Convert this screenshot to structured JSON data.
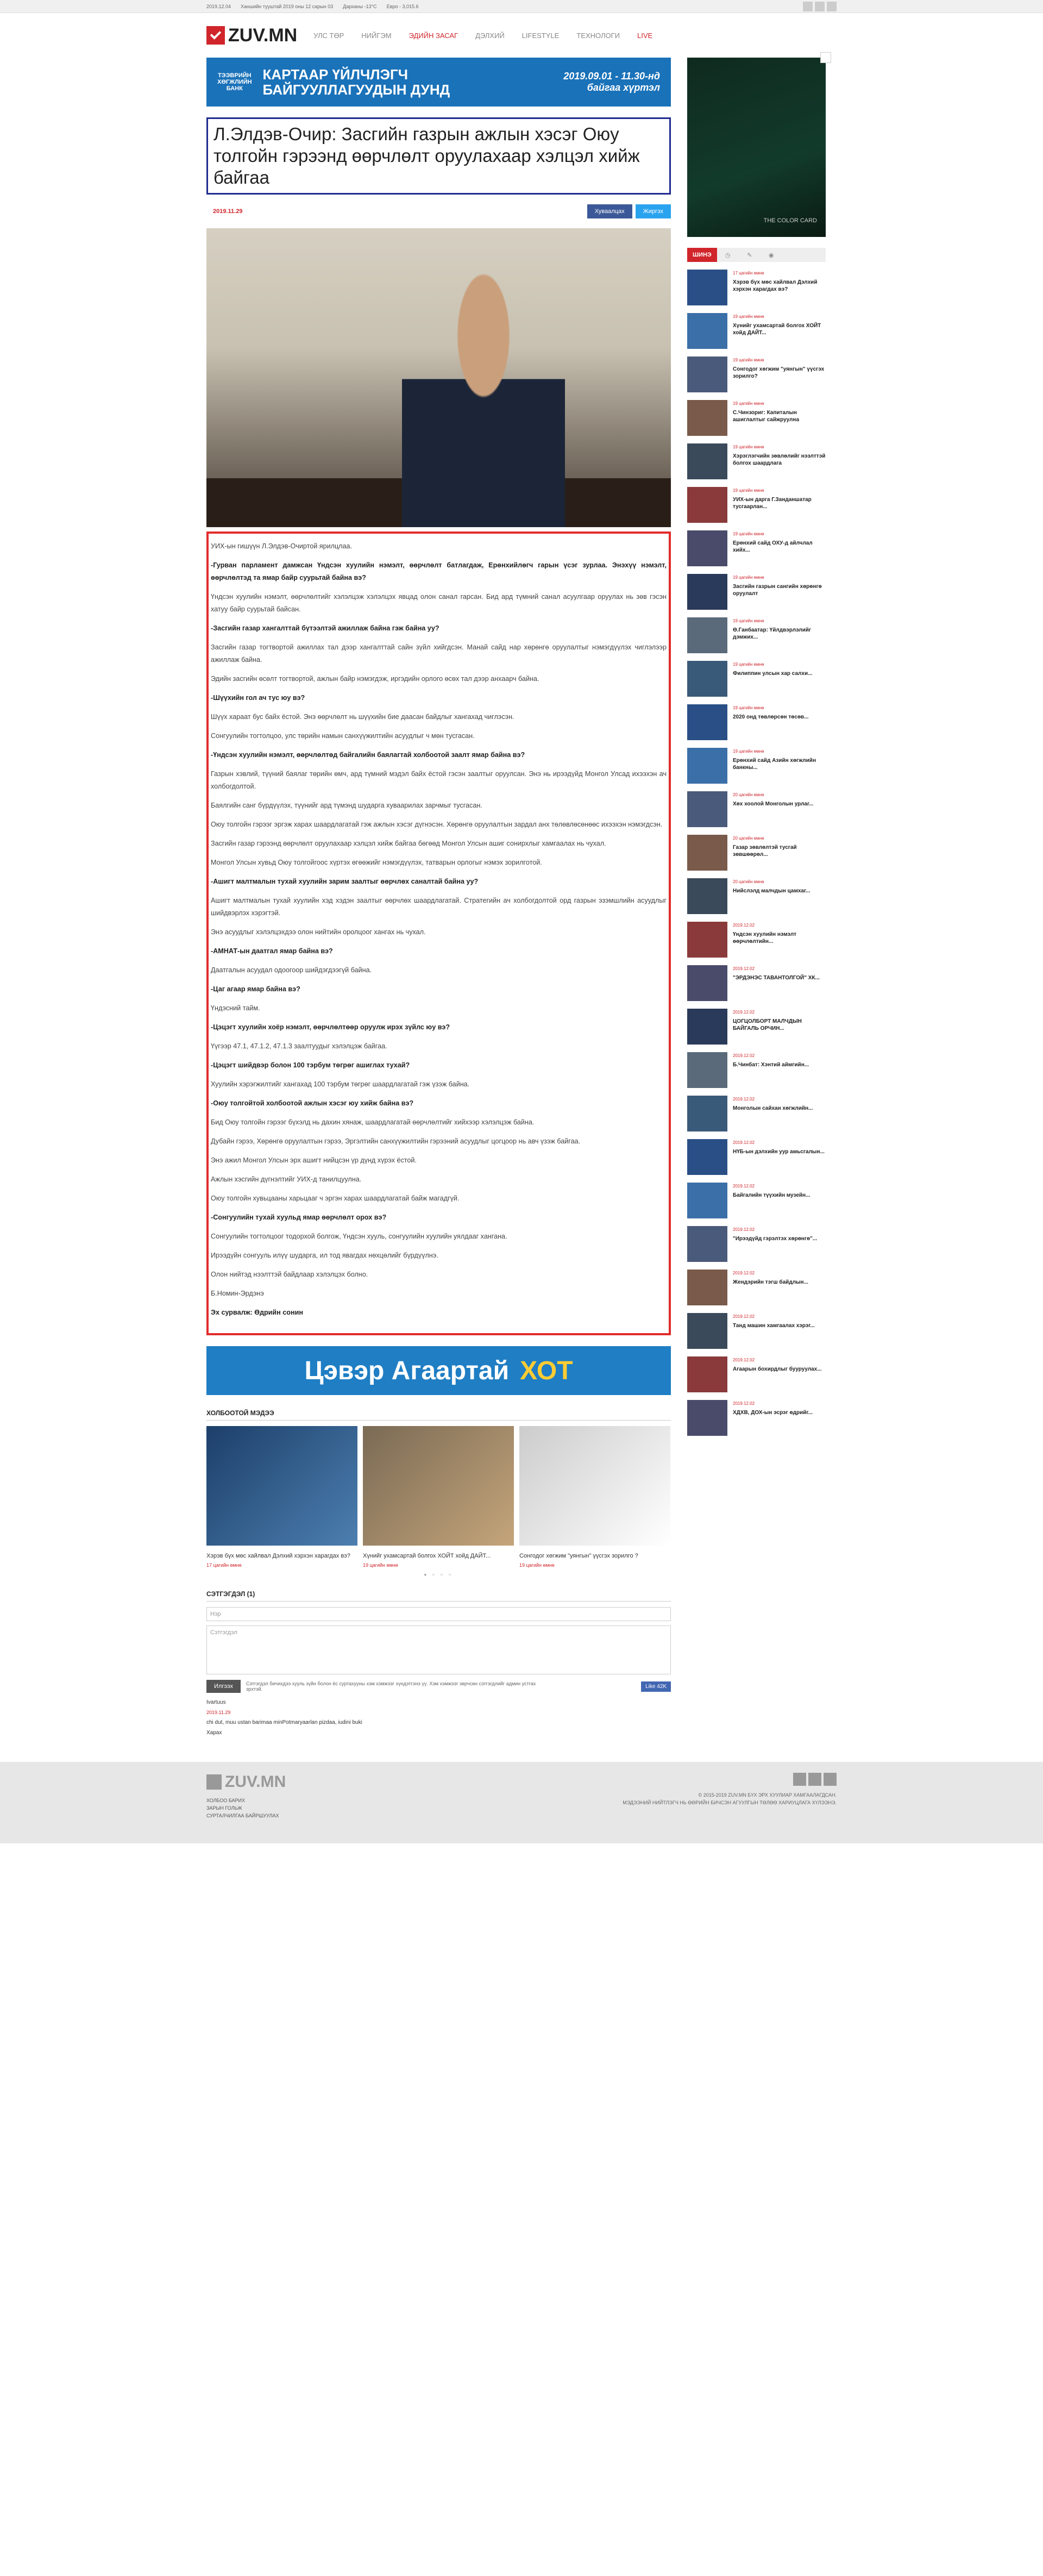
{
  "topbar": {
    "date": "2019.12.04",
    "exchange": "Ханшийн тууштай 2019 оны 12 сарын 03",
    "weather": "Дарханы -13°С",
    "currency": "Евро - 3,015.6"
  },
  "header": {
    "logo": "ZUV.MN",
    "nav": [
      "УЛС ТӨР",
      "НИЙГЭМ",
      "ЭДИЙН ЗАСАГ",
      "ДЭЛХИЙ",
      "LIFESTYLE",
      "ТЕХНОЛОГИ",
      "LIVE"
    ]
  },
  "banner1": {
    "brand": "ТЭЭВРИЙН ХӨГЖЛИЙН БАНК",
    "text": "КАРТААР ҮЙЛЧЛЭГЧ БАЙГУУЛЛАГУУДЫН ДУНД",
    "date": "2019.09.01 - 11.30-нд байгаа хүртэл"
  },
  "article": {
    "title": "Л.Элдэв-Очир: Засгийн газрын ажлын хэсэг Оюу толгойн гэрээнд өөрчлөлт оруулахаар хэлцэл хийж байгаа",
    "date": "2019.11.29",
    "share_fb": "Хуваалцах",
    "share_tw": "Жиргэх",
    "paragraphs": [
      {
        "q": false,
        "text": "УИХ-ын гишүүн Л.Элдэв-Очиртой ярилцлаа."
      },
      {
        "q": true,
        "text": "-Гурван парламент дамжсан Үндсэн хуулийн нэмэлт, өөрчлөлт батлагдаж, Ерөнхийлөгч гарын үсэг зурлаа. Энэхүү нэмэлт, өөрчлөлтэд та ямар байр суурьтай байна вэ?"
      },
      {
        "q": false,
        "text": "Үндсэн хуулийн нэмэлт, өөрчлөлтийг хэлэлцэж хэлэлцэх явцад олон санал гарсан. Бид ард түмний санал асуулгаар оруулах нь зөв гэсэн хатуу байр суурьтай байсан."
      },
      {
        "q": true,
        "text": "-Засгийн газар хангалттай бүтээлтэй ажиллаж байна гэж байна уу?"
      },
      {
        "q": false,
        "text": "Засгийн газар тогтвортой ажиллах тал дээр хангалттай сайн зүйл хийгдсэн. Манай сайд нар хөрөнгө оруулалтыг нэмэгдүүлэх чиглэлээр ажиллаж байна."
      },
      {
        "q": false,
        "text": "Эдийн засгийн өсөлт тогтвортой, ажлын байр нэмэгдэж, иргэдийн орлого өсөх тал дээр анхаарч байна."
      },
      {
        "q": true,
        "text": "-Шүүхийн гол ач тус юу вэ?"
      },
      {
        "q": false,
        "text": "Шүүх хараат бус байх ёстой. Энэ өөрчлөлт нь шүүхийн бие даасан байдлыг хангахад чиглэсэн."
      },
      {
        "q": false,
        "text": "Сонгуулийн тогтолцоо, улс төрийн намын санхүүжилтийн асуудлыг ч мөн тусгасан."
      },
      {
        "q": true,
        "text": "-Үндсэн хуулийн нэмэлт, өөрчлөлтөд байгалийн баялагтай холбоотой заалт ямар байна вэ?"
      },
      {
        "q": false,
        "text": "Газрын хэвлий, түүний баялаг төрийн өмч, ард түмний мэдэл байх ёстой гэсэн заалтыг оруулсан. Энэ нь ирээдүйд Монгол Улсад ихээхэн ач холбогдолтой."
      },
      {
        "q": false,
        "text": "Баялгийн санг бүрдүүлэх, түүнийг ард түмэнд шударга хуваарилах зарчмыг тусгасан."
      },
      {
        "q": false,
        "text": "Оюу толгойн гэрээг эргэж харах шаардлагатай гэж ажлын хэсэг дүгнэсэн. Хөрөнгө оруулалтын зардал анх төлөвлөсөнөөс ихээхэн нэмэгдсэн."
      },
      {
        "q": false,
        "text": "Засгийн газар гэрээнд өөрчлөлт оруулахаар хэлцэл хийж байгаа бөгөөд Монгол Улсын ашиг сонирхлыг хамгаалах нь чухал."
      },
      {
        "q": false,
        "text": "Монгол Улсын хувьд Оюу толгойгоос хүртэх өгөөжийг нэмэгдүүлэх, татварын орлогыг нэмэх зорилготой."
      },
      {
        "q": true,
        "text": "-Ашигт малтмалын тухай хуулийн зарим заалтыг өөрчлөх саналтай байна уу?"
      },
      {
        "q": false,
        "text": "Ашигт малтмалын тухай хуулийн хэд хэдэн заалтыг өөрчлөх шаардлагатай. Стратегийн ач холбогдолтой орд газрын эзэмшлийн асуудлыг шийдвэрлэх хэрэгтэй."
      },
      {
        "q": false,
        "text": "Энэ асуудлыг хэлэлцэхдээ олон нийтийн оролцоог хангах нь чухал."
      },
      {
        "q": true,
        "text": "-АМНАТ-ын даатгал ямар байна вэ?"
      },
      {
        "q": false,
        "text": "Даатгалын асуудал одоогоор шийдэгдээгүй байна."
      },
      {
        "q": true,
        "text": "-Цаг агаар ямар байна вэ?"
      },
      {
        "q": false,
        "text": "Үндэсний тайм."
      },
      {
        "q": true,
        "text": "-Цэцэгт хуулийн хоёр нэмэлт, өөрчлөлтөөр оруулж ирэх зүйлс юу вэ?"
      },
      {
        "q": false,
        "text": "Үүгээр 47.1, 47.1.2, 47.1.3 заалтуудыг хэлэлцэж байгаа."
      },
      {
        "q": true,
        "text": "-Цэцэгт шийдвэр болон 100 тэрбум төгрөг ашиглах тухай?"
      },
      {
        "q": false,
        "text": "Хуулийн хэрэгжилтийг хангахад 100 тэрбум төгрөг шаардлагатай гэж үзэж байна."
      },
      {
        "q": true,
        "text": "-Оюу толгойтой холбоотой ажлын хэсэг юу хийж байна вэ?"
      },
      {
        "q": false,
        "text": "Бид Оюу толгойн гэрээг бүхэлд нь дахин хянаж, шаардлагатай өөрчлөлтийг хийхээр хэлэлцэж байна."
      },
      {
        "q": false,
        "text": "Дубайн гэрээ, Хөрөнгө оруулалтын гэрээ, Эргэлтийн санхүүжилтийн гэрээний асуудлыг цогцоор нь авч үзэж байгаа."
      },
      {
        "q": false,
        "text": "Энэ ажил Монгол Улсын эрх ашигт нийцсэн үр дүнд хүрэх ёстой."
      },
      {
        "q": false,
        "text": "Ажлын хэсгийн дүгнэлтийг УИХ-д танилцуулна."
      },
      {
        "q": false,
        "text": "Оюу толгойн хувьцааны харьцааг ч эргэн харах шаардлагатай байж магадгүй."
      },
      {
        "q": true,
        "text": "-Сонгуулийн тухай хуульд ямар өөрчлөлт орох вэ?"
      },
      {
        "q": false,
        "text": "Сонгуулийн тогтолцоог тодорхой болгож, Үндсэн хууль, сонгуулийн хуулийн уялдааг хангана."
      },
      {
        "q": false,
        "text": "Ирээдүйн сонгууль илүү шударга, ил тод явагдах нөхцөлийг бүрдүүлнэ."
      },
      {
        "q": false,
        "text": "Олон нийтэд нээлттэй байдлаар хэлэлцэх болно."
      },
      {
        "q": false,
        "text": "Б.Номин-Эрдэнэ"
      },
      {
        "q": true,
        "text": "Эх сурвалж: Өдрийн сонин"
      }
    ]
  },
  "banner2": {
    "text": "Цэвэр Агаартай",
    "hot": "ХОТ"
  },
  "related": {
    "title": "ХОЛБООТОЙ МЭДЭЭ",
    "items": [
      {
        "title": "Хэрэв бүх мөс хайлвал Дэлхий хэрхэн харагдах вэ?",
        "date": "17 цагийн өмнө"
      },
      {
        "title": "Хүнийг ухамсартай болгох ХОЙТ хойд ДАЙТ...",
        "date": "19 цагийн өмнө"
      },
      {
        "title": "Сонгодог хөгжим \"уянгын\" үүсгэх зорилго ?",
        "date": "19 цагийн өмнө"
      }
    ],
    "dots": "● ○ ○ ○"
  },
  "comments": {
    "title": "СЭТГЭГДЭЛ (1)",
    "name_placeholder": "Нэр",
    "text_placeholder": "Сэтгэгдэл",
    "send": "Илгээх",
    "note": "Сэтгэгдэл бичихдээ хууль зүйн болон ёс суртахууны хэм хэмжээг хүндэтгэнэ үү. Хэм хэмжээг зөрчсөн сэтгэгдлийг админ устгах эрхтэй.",
    "like": "Like 42K",
    "entries": [
      {
        "author": "Ivartuus",
        "date": "2019.11.29",
        "text": "chi dut, muu ustan barimaa minPotmaryaarlan pizdaa, iudini buki"
      },
      {
        "author": "Харах",
        "date": "",
        "text": ""
      }
    ]
  },
  "sidebar": {
    "ad_caption": "THE COLOR CARD",
    "tab_label": "ШИНЭ",
    "items": [
      {
        "date": "17 цагийн өмнө",
        "title": "Хэрэв бүх мөс хайлвал Дэлхий хэрхэн харагдах вэ?"
      },
      {
        "date": "19 цагийн өмнө",
        "title": "Хүнийг ухамсартай болгох ХОЙТ хойд ДАЙТ..."
      },
      {
        "date": "19 цагийн өмнө",
        "title": "Сонгодог хөгжим \"уянгын\" үүсгэх зорилго?"
      },
      {
        "date": "19 цагийн өмнө",
        "title": "С.Чинзориг: Капиталын ашиглалтыг сайжруулна"
      },
      {
        "date": "19 цагийн өмнө",
        "title": "Хэрэглэгчийн зөвлөлийг нээлттэй болгох шаардлага"
      },
      {
        "date": "19 цагийн өмнө",
        "title": "УИХ-ын дарга Г.Занданшатар тусгаарлан..."
      },
      {
        "date": "19 цагийн өмнө",
        "title": "Ерөнхий сайд ОХУ-д айлчлал хийх..."
      },
      {
        "date": "19 цагийн өмнө",
        "title": "Засгийн газрын сангийн хөрөнгө оруулалт"
      },
      {
        "date": "19 цагийн өмнө",
        "title": "Ө.Ганбаатар: Үйлдвэрлэлийг дэмжих..."
      },
      {
        "date": "19 цагийн өмнө",
        "title": "Филиппин улсын хар салхи..."
      },
      {
        "date": "19 цагийн өмнө",
        "title": "2020 онд төвлөрсөн төсөв..."
      },
      {
        "date": "19 цагийн өмнө",
        "title": "Ерөнхий сайд Азийн хөгжлийн банкны..."
      },
      {
        "date": "20 цагийн өмнө",
        "title": "Хөх хоолой Монголын урлаг..."
      },
      {
        "date": "20 цагийн өмнө",
        "title": "Газар зөвлөлтэй тусгай зөвшөөрөл..."
      },
      {
        "date": "20 цагийн өмнө",
        "title": "Нийслэлд малчдын цамхаг..."
      },
      {
        "date": "2019.12.02",
        "title": "Үндсэн хуулийн нэмэлт өөрчлөлтийн..."
      },
      {
        "date": "2019.12.02",
        "title": "\"ЭРДЭНЭС ТАВАНТОЛГОЙ\" ХК..."
      },
      {
        "date": "2019.12.02",
        "title": "ЦОГЦОЛБОРТ МАЛЧДЫН БАЙГАЛЬ ОРЧИН..."
      },
      {
        "date": "2019.12.02",
        "title": "Б.Чинбат: Хэнтий аймгийн..."
      },
      {
        "date": "2019.12.02",
        "title": "Монголын сайхан хөгжлийн..."
      },
      {
        "date": "2019.12.02",
        "title": "НҮБ-ын дэлхийн уур амьсгалын..."
      },
      {
        "date": "2019.12.02",
        "title": "Байгалийн түүхийн музейн..."
      },
      {
        "date": "2019.12.02",
        "title": "\"Ирээдүйд гэрэлтэх хөрөнгө\"..."
      },
      {
        "date": "2019.12.02",
        "title": "Жендэрийн тэгш байдлын..."
      },
      {
        "date": "2019.12.02",
        "title": "Танд машин хамгаалах хэрэг..."
      },
      {
        "date": "2019.12.02",
        "title": "Агаарын бохирдлыг бууруулах..."
      },
      {
        "date": "2019.12.02",
        "title": "ХДХВ, ДОХ-ын эсрэг өдрийг..."
      }
    ]
  },
  "footer": {
    "logo": "ZUV.MN",
    "links": [
      "ХОЛБОО БАРИХ",
      "ЗАРЫН ГОЛЬЖ",
      "СУРТАЛЧИЛГАА БАЙРШУУЛАХ"
    ],
    "copyright": "© 2015-2019 ZUV.MN БҮХ ЭРХ ХУУЛИАР ХАМГААЛАГДСАН.",
    "notice": "МЭДЭЭНИЙ НИЙТЛЭГЧ НЬ ӨӨРИЙН БИЧСЭН АГУУЛГЫН ТӨЛӨӨ ХАРИУЦЛАГА ХҮЛЭЭНЭ."
  }
}
